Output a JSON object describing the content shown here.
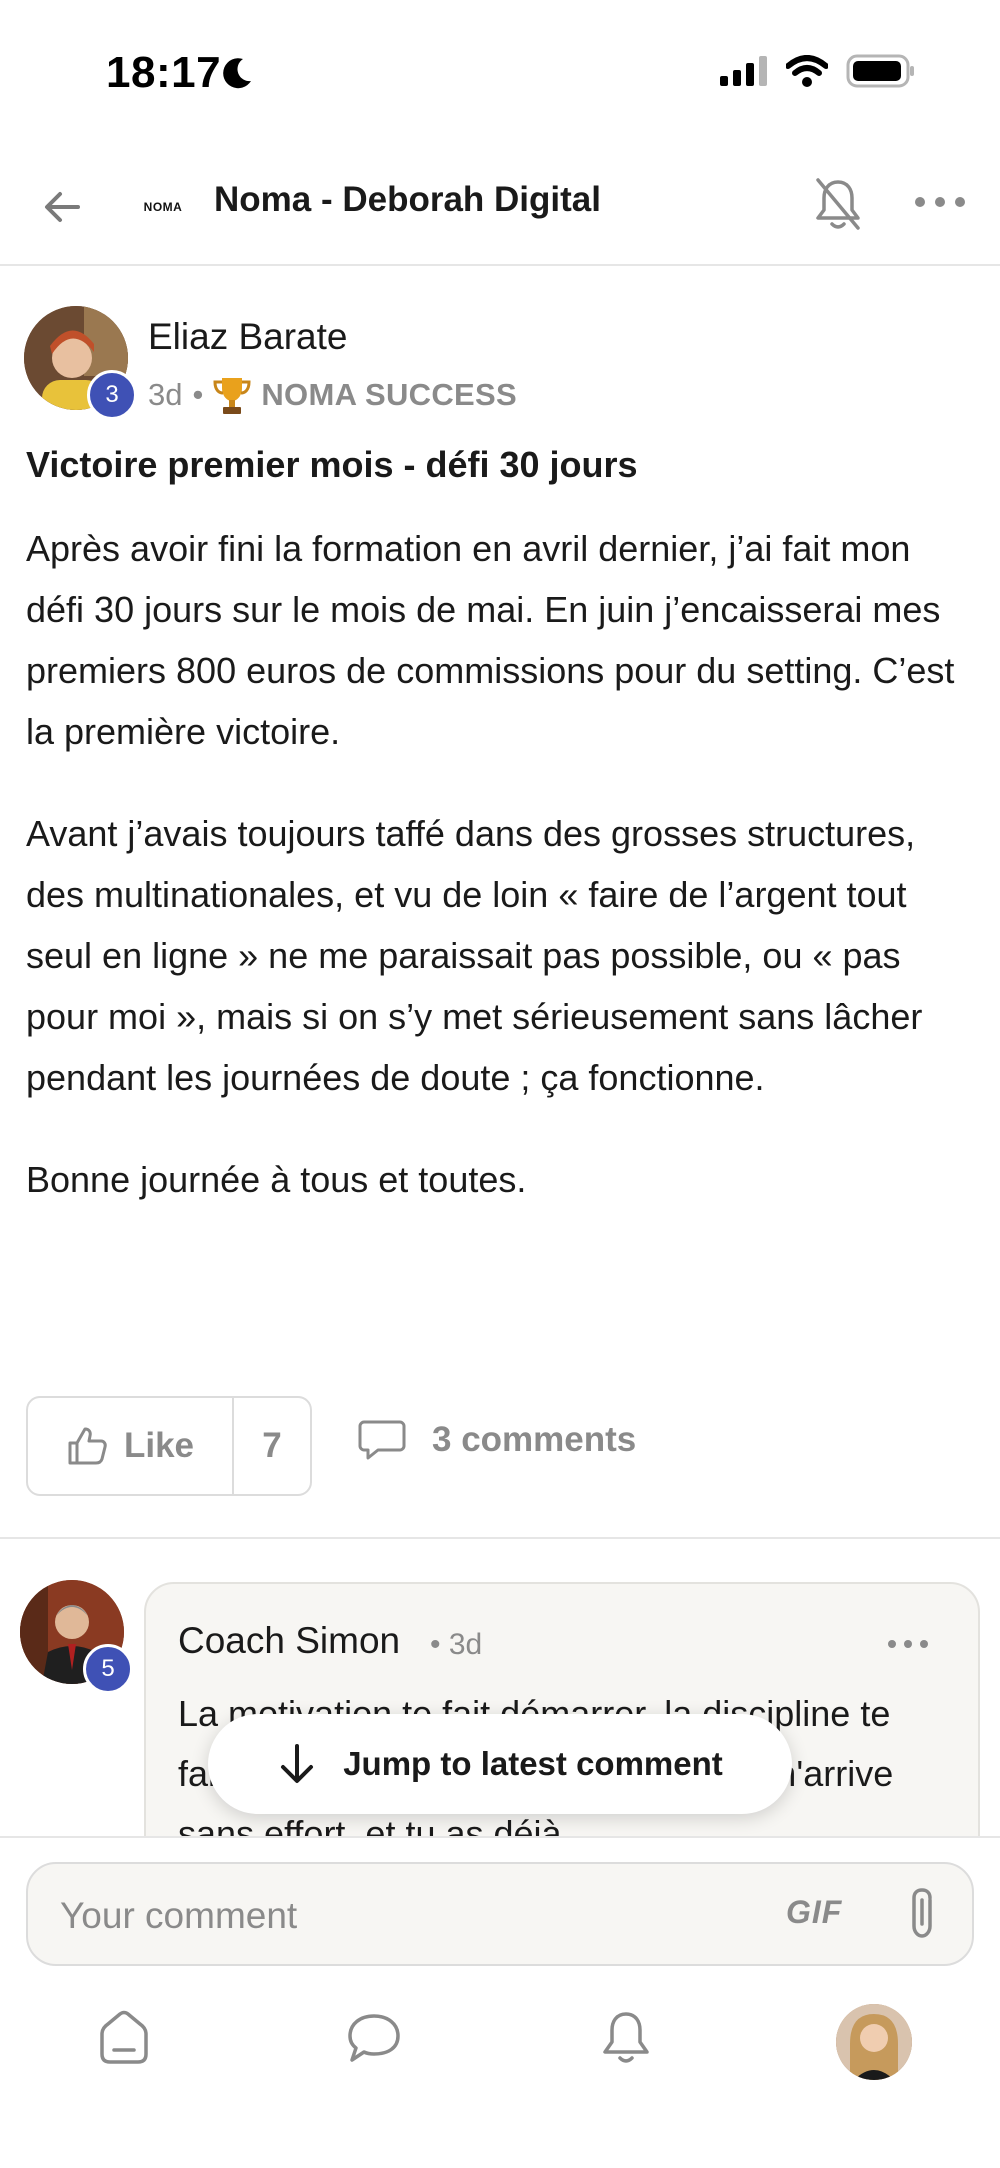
{
  "status_bar": {
    "time": "18:17"
  },
  "header": {
    "logo_text": "NOMA",
    "title": "Noma - Deborah Digital"
  },
  "post": {
    "author": "Eliaz Barate",
    "author_level": "3",
    "age": "3d",
    "separator": "•",
    "category": "NOMA SUCCESS",
    "title": "Victoire premier mois - défi 30 jours",
    "paragraphs": [
      "Après avoir fini la formation en avril dernier, j’ai fait mon défi 30 jours sur le mois de mai. En juin j’encaisserai mes premiers 800 euros de commissions pour du setting. C’est la première victoire.",
      "Avant j’avais toujours taffé dans des grosses structures, des multinationales, et vu de loin « faire de l’argent tout seul en ligne » ne me paraissait pas possible, ou « pas pour moi », mais si on s’y met sérieusement sans lâcher pendant les journées de doute ; ça fonctionne.",
      "Bonne journée à tous et toutes."
    ],
    "like_label": "Like",
    "like_count": "7",
    "comments_label": "3 comments"
  },
  "comment": {
    "author": "Coach Simon",
    "author_level": "5",
    "meta": "• 3d",
    "text": "La motivation te fait démarrer, la discipline te fait continuer. Tu as compris que rien n'arrive sans effort, et tu as déjà"
  },
  "jump_button": {
    "label": "Jump to latest comment"
  },
  "composer": {
    "placeholder": "Your comment",
    "gif_label": "GIF"
  },
  "icons": {
    "back": "arrow-left-icon",
    "notifications_off": "bell-off-icon",
    "more": "more-horizontal-icon",
    "trophy": "trophy-icon",
    "like": "thumbs-up-icon",
    "comments": "speech-bubble-icon",
    "jump": "arrow-down-icon",
    "attach": "paperclip-icon",
    "nav": [
      "home-icon",
      "chat-icon",
      "bell-icon",
      "profile-avatar"
    ]
  },
  "colors": {
    "badge": "#3f51b5",
    "muted_text": "#8a8a8a",
    "bubble_bg": "#f7f6f3",
    "border": "#dcdcdc"
  }
}
